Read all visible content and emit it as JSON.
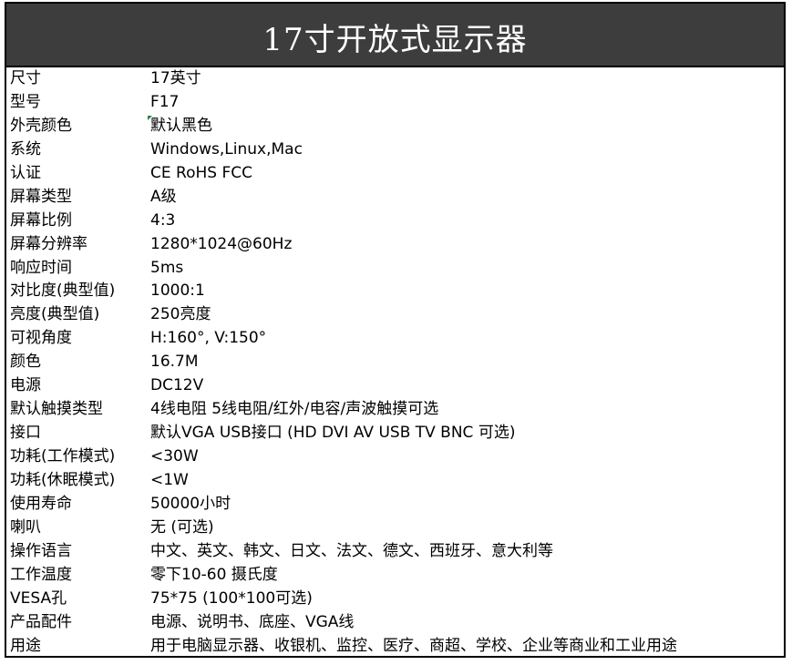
{
  "title": "17寸开放式显示器",
  "rows": [
    {
      "label": "尺寸",
      "value": "17英寸"
    },
    {
      "label": "型号",
      "value": "F17"
    },
    {
      "label": "外壳颜色",
      "value": "默认黑色"
    },
    {
      "label": "系统",
      "value": "Windows,Linux,Mac"
    },
    {
      "label": "认证",
      "value": "CE RoHS FCC"
    },
    {
      "label": "屏幕类型",
      "value": "A级"
    },
    {
      "label": "屏幕比例",
      "value": "4:3"
    },
    {
      "label": "屏幕分辨率",
      "value": "1280*1024@60Hz"
    },
    {
      "label": "响应时间",
      "value": "5ms"
    },
    {
      "label": "对比度(典型值)",
      "value": "1000:1"
    },
    {
      "label": "亮度(典型值)",
      "value": "250亮度"
    },
    {
      "label": "可视角度",
      "value": "H:160°,  V:150°"
    },
    {
      "label": "颜色",
      "value": "16.7M"
    },
    {
      "label": "电源",
      "value": "DC12V"
    },
    {
      "label": "默认触摸类型",
      "value": "4线电阻 5线电阻/红外/电容/声波触摸可选"
    },
    {
      "label": "接口",
      "value": "默认VGA USB接口 (HD DVI AV USB TV BNC 可选)"
    },
    {
      "label": "功耗(工作模式)",
      "value": "<30W"
    },
    {
      "label": "功耗(休眠模式)",
      "value": "<1W"
    },
    {
      "label": "使用寿命",
      "value": "50000小时"
    },
    {
      "label": "喇叭",
      "value": "无 (可选)"
    },
    {
      "label": "操作语言",
      "value": "中文、英文、韩文、日文、法文、德文、西班牙、意大利等"
    },
    {
      "label": "工作温度",
      "value": "零下10-60 摄氏度"
    },
    {
      "label": "VESA孔",
      "value": "75*75 (100*100可选)"
    },
    {
      "label": "产品配件",
      "value": "电源、说明书、底座、VGA线"
    },
    {
      "label": "用途",
      "value": "用于电脑显示器、收银机、监控、医疗、商超、学校、企业等商业和工业用途"
    }
  ]
}
